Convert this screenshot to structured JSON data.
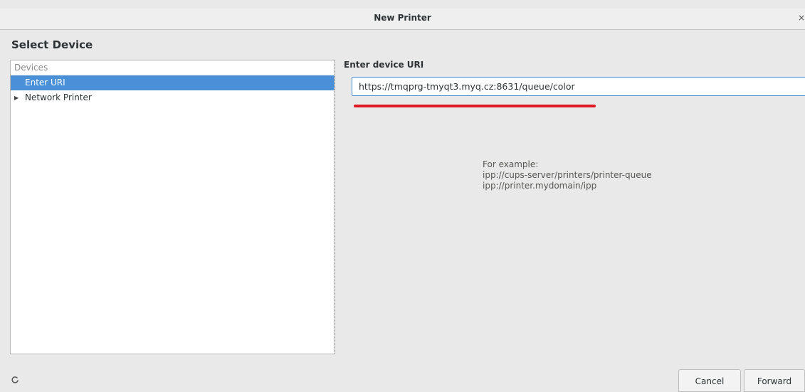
{
  "window": {
    "title": "New Printer",
    "close_glyph": "×"
  },
  "page": {
    "section_title": "Select Device"
  },
  "devices": {
    "header": "Devices",
    "items": [
      {
        "label": "Enter URI",
        "selected": true
      },
      {
        "label": "Network Printer",
        "expandable": true
      }
    ]
  },
  "uri": {
    "label": "Enter device URI",
    "value": "https://tmqprg-tmyqt3.myq.cz:8631/queue/color"
  },
  "example": {
    "heading": "For example:",
    "lines": [
      "ipp://cups-server/printers/printer-queue",
      "ipp://printer.mydomain/ipp"
    ]
  },
  "buttons": {
    "cancel": "Cancel",
    "forward": "Forward"
  },
  "colors": {
    "accent": "#4a90d9",
    "annotation": "#e01b24"
  }
}
